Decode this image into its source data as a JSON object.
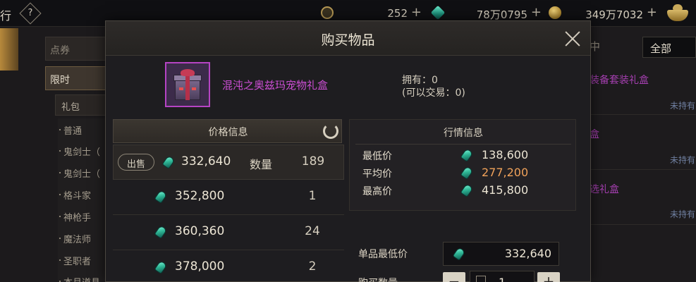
{
  "topbar": {
    "title": "行",
    "help": "?",
    "currencies": [
      {
        "value": "252",
        "plus": "+",
        "icon": "ring-icon"
      },
      {
        "value": "78万0795",
        "plus": "+",
        "icon": "gem-icon"
      },
      {
        "value": "349万7032",
        "plus": "+",
        "icon": "gold-coin-icon"
      }
    ]
  },
  "sidebar": {
    "tab1": "点券",
    "tab2": "限时",
    "sub": "礼包",
    "rows": [
      "普通",
      "鬼剑士（",
      "鬼剑士（",
      "格斗家",
      "神枪手",
      "魔法师",
      "圣职者",
      "本月道具"
    ]
  },
  "right_panel": {
    "mid": "中",
    "filter": "全部",
    "items": [
      {
        "name": "装备套装礼盒",
        "status": "未持有"
      },
      {
        "name": "盒",
        "status": "未持有"
      },
      {
        "name": "选礼盒",
        "status": "未持有"
      }
    ]
  },
  "modal": {
    "title": "购买物品",
    "item": {
      "name": "混沌之奥兹玛宠物礼盒",
      "owned": "拥有：0",
      "tradable": "(可以交易：0)"
    },
    "price_info": {
      "title": "价格信息",
      "sell_label": "出售",
      "qty_label": "数量",
      "rows": [
        {
          "price": "332,640",
          "qty": "189"
        },
        {
          "price": "352,800",
          "qty": "1"
        },
        {
          "price": "360,360",
          "qty": "24"
        },
        {
          "price": "378,000",
          "qty": "2"
        }
      ]
    },
    "market_info": {
      "title": "行情信息",
      "min_label": "最低价",
      "min_value": "138,600",
      "avg_label": "平均价",
      "avg_value": "277,200",
      "max_label": "最高价",
      "max_value": "415,800"
    },
    "lowest_price_label": "单品最低价",
    "lowest_price_value": "332,640",
    "buy_qty_label": "购买数量",
    "buy_qty_value": "1",
    "minus": "−",
    "plus": "+"
  }
}
